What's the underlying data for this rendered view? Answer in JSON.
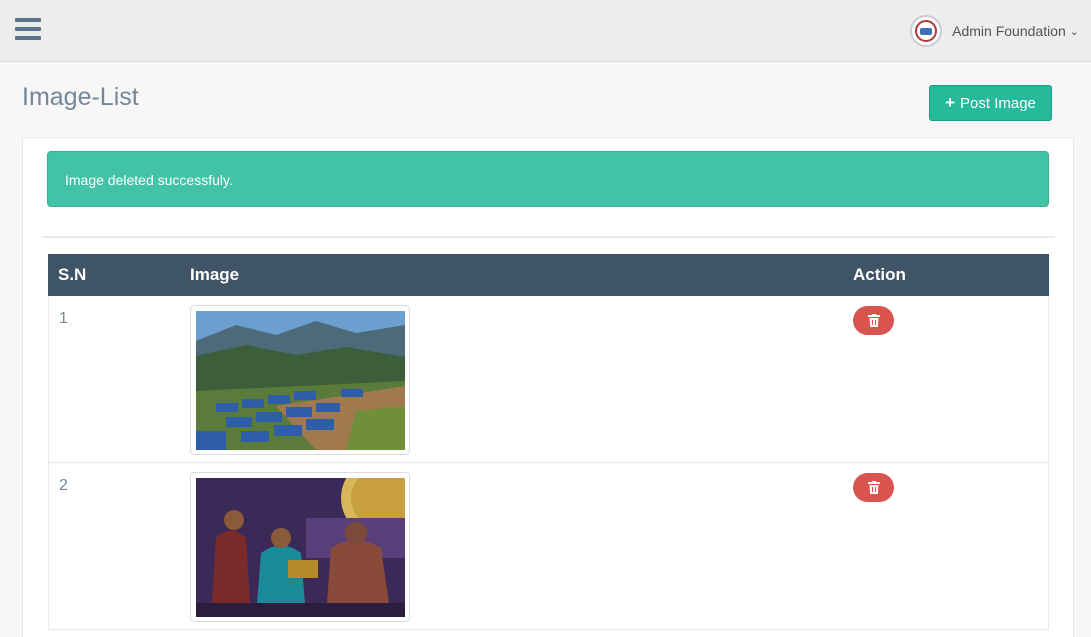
{
  "topbar": {
    "menu_icon": "hamburger-menu-icon",
    "user_name": "Admin Foundation",
    "dropdown_icon": "chevron-down-icon"
  },
  "page": {
    "title": "Image-List",
    "post_button_label": "Post Image",
    "post_button_icon": "plus-icon"
  },
  "alert": {
    "message": "Image deleted successfuly."
  },
  "table": {
    "headers": [
      "S.N",
      "Image",
      "Action"
    ],
    "rows": [
      {
        "sn": "1",
        "image_alt": "Hillside settlement with blue-roofed houses",
        "action_icon": "trash-icon"
      },
      {
        "sn": "2",
        "image_alt": "Award ceremony on stage",
        "action_icon": "trash-icon"
      }
    ]
  },
  "colors": {
    "accent": "#26b99a",
    "alert": "#42c2a6",
    "table_header": "#405467",
    "danger": "#d9534f"
  }
}
